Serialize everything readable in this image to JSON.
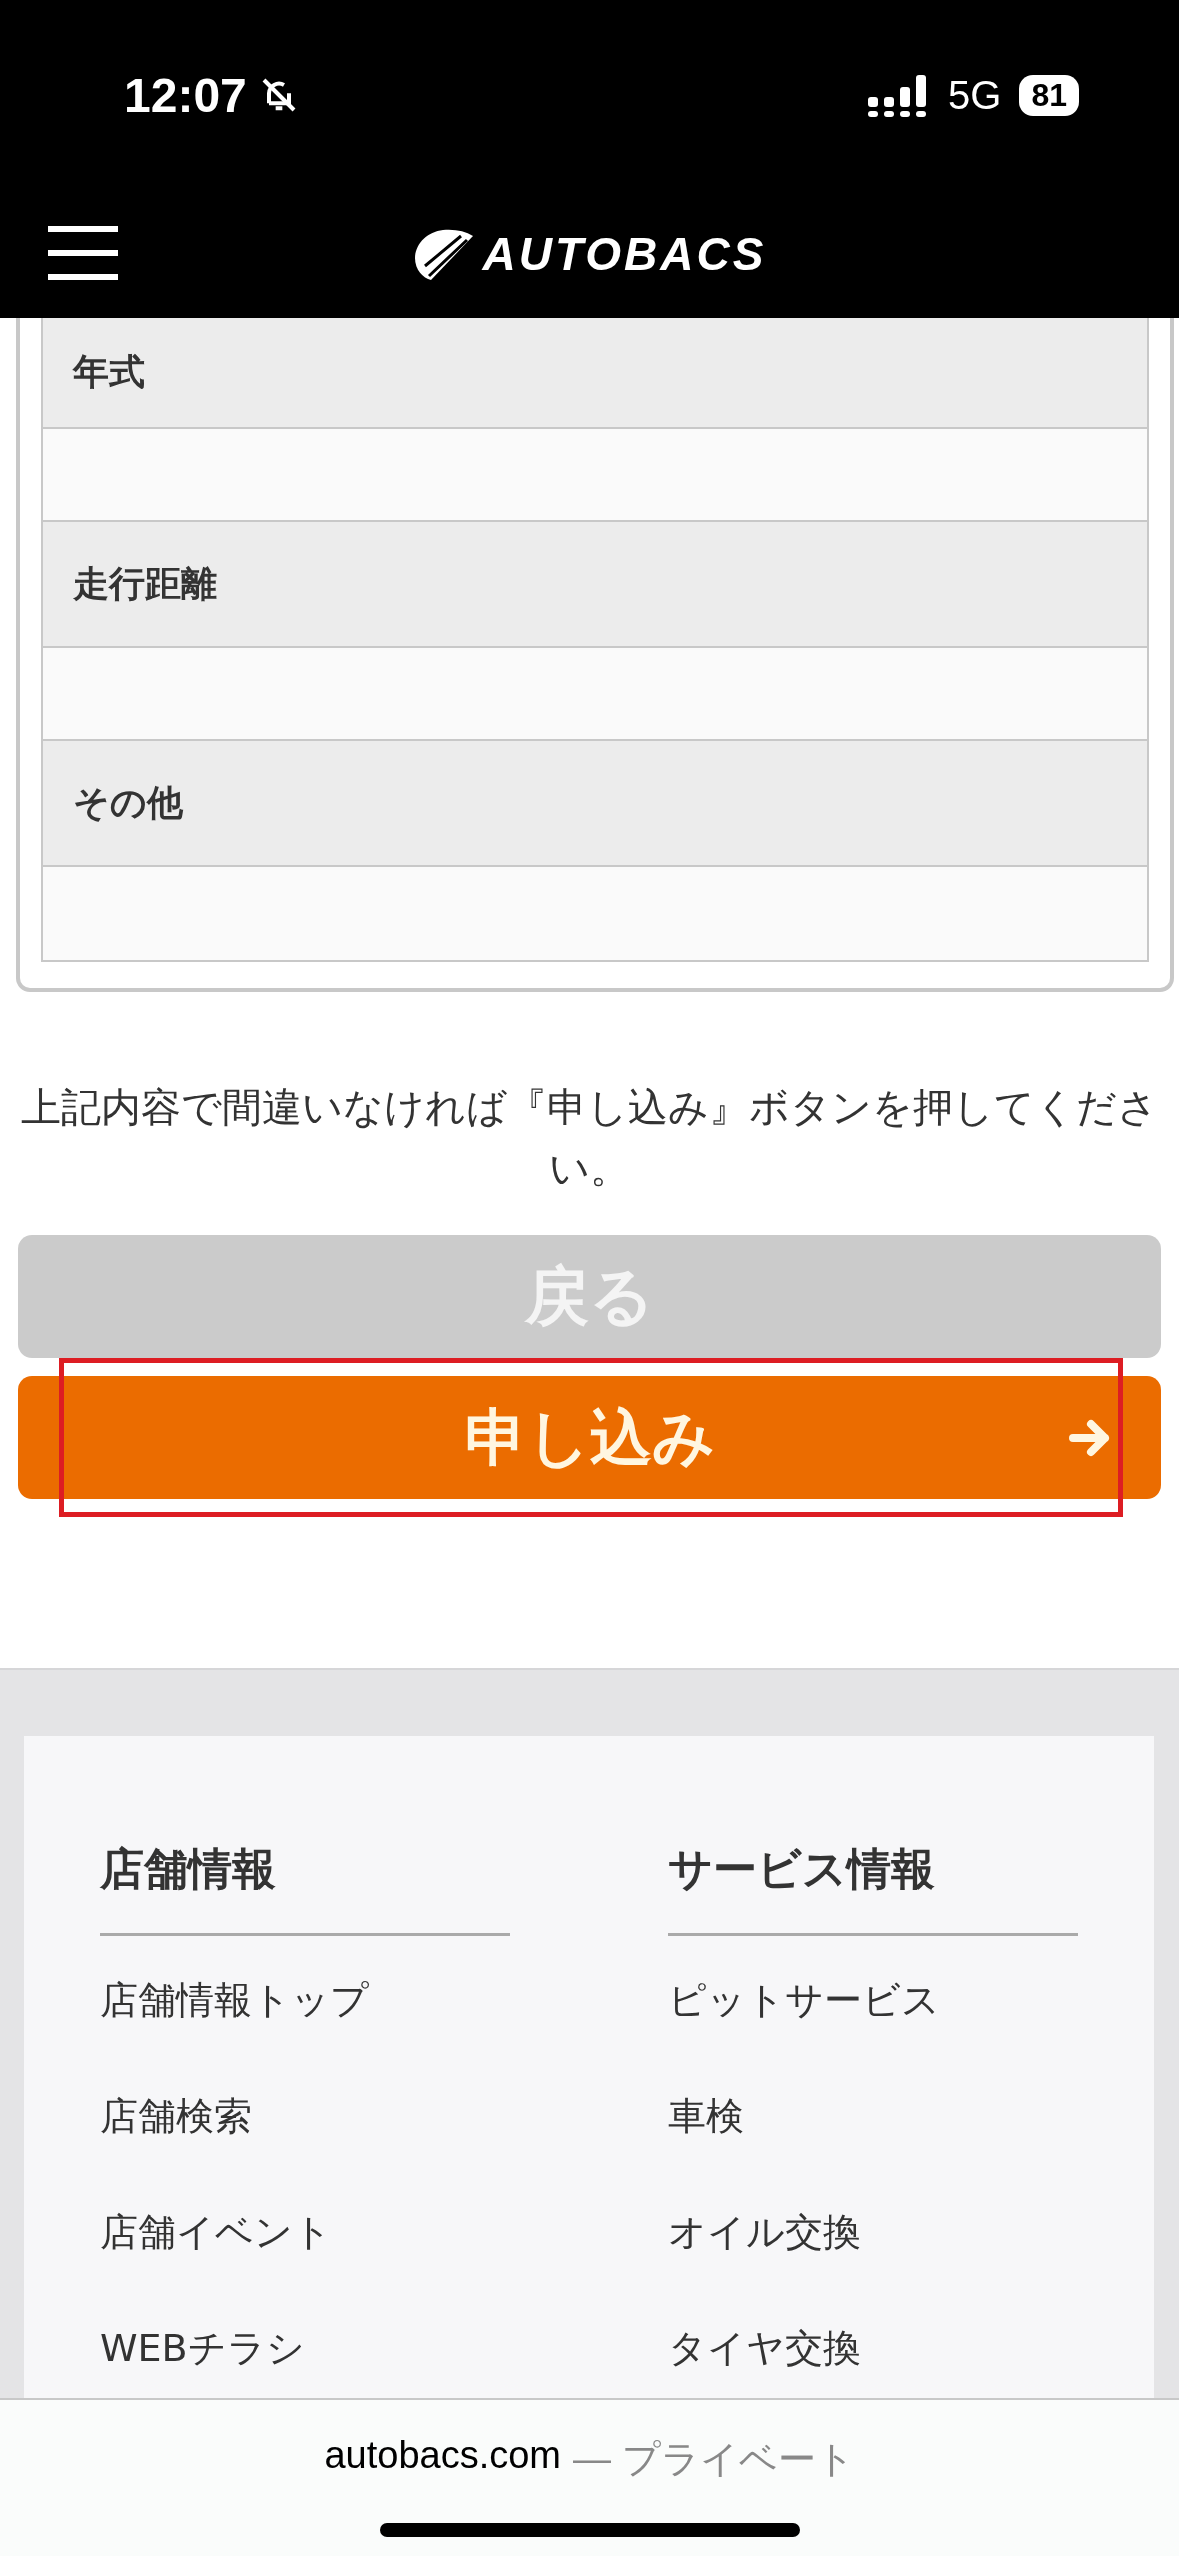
{
  "status_bar": {
    "time": "12:07",
    "network": "5G",
    "battery": "81",
    "silent": true
  },
  "header": {
    "logo": "AUTOBACS"
  },
  "table": {
    "rows": [
      {
        "label": "年式"
      },
      {
        "label": "走行距離"
      },
      {
        "label": "その他"
      }
    ]
  },
  "confirm_text": "上記内容で間違いなければ『申し込み』ボタンを押してください。",
  "buttons": [
    {
      "label": "戻る",
      "kind": "back",
      "highlighted": false
    },
    {
      "label": "申し込み",
      "kind": "submit",
      "highlighted": true
    }
  ],
  "footer": {
    "columns": [
      {
        "heading": "店舗情報",
        "links": [
          "店舗情報トップ",
          "店舗検索",
          "店舗イベント",
          "WEBチラシ"
        ]
      },
      {
        "heading": "サービス情報",
        "links": [
          "ピットサービス",
          "車検",
          "オイル交換",
          "タイヤ交換"
        ]
      }
    ]
  },
  "browser_bar": {
    "domain": "autobacs.com",
    "mode": "— プライベート"
  }
}
